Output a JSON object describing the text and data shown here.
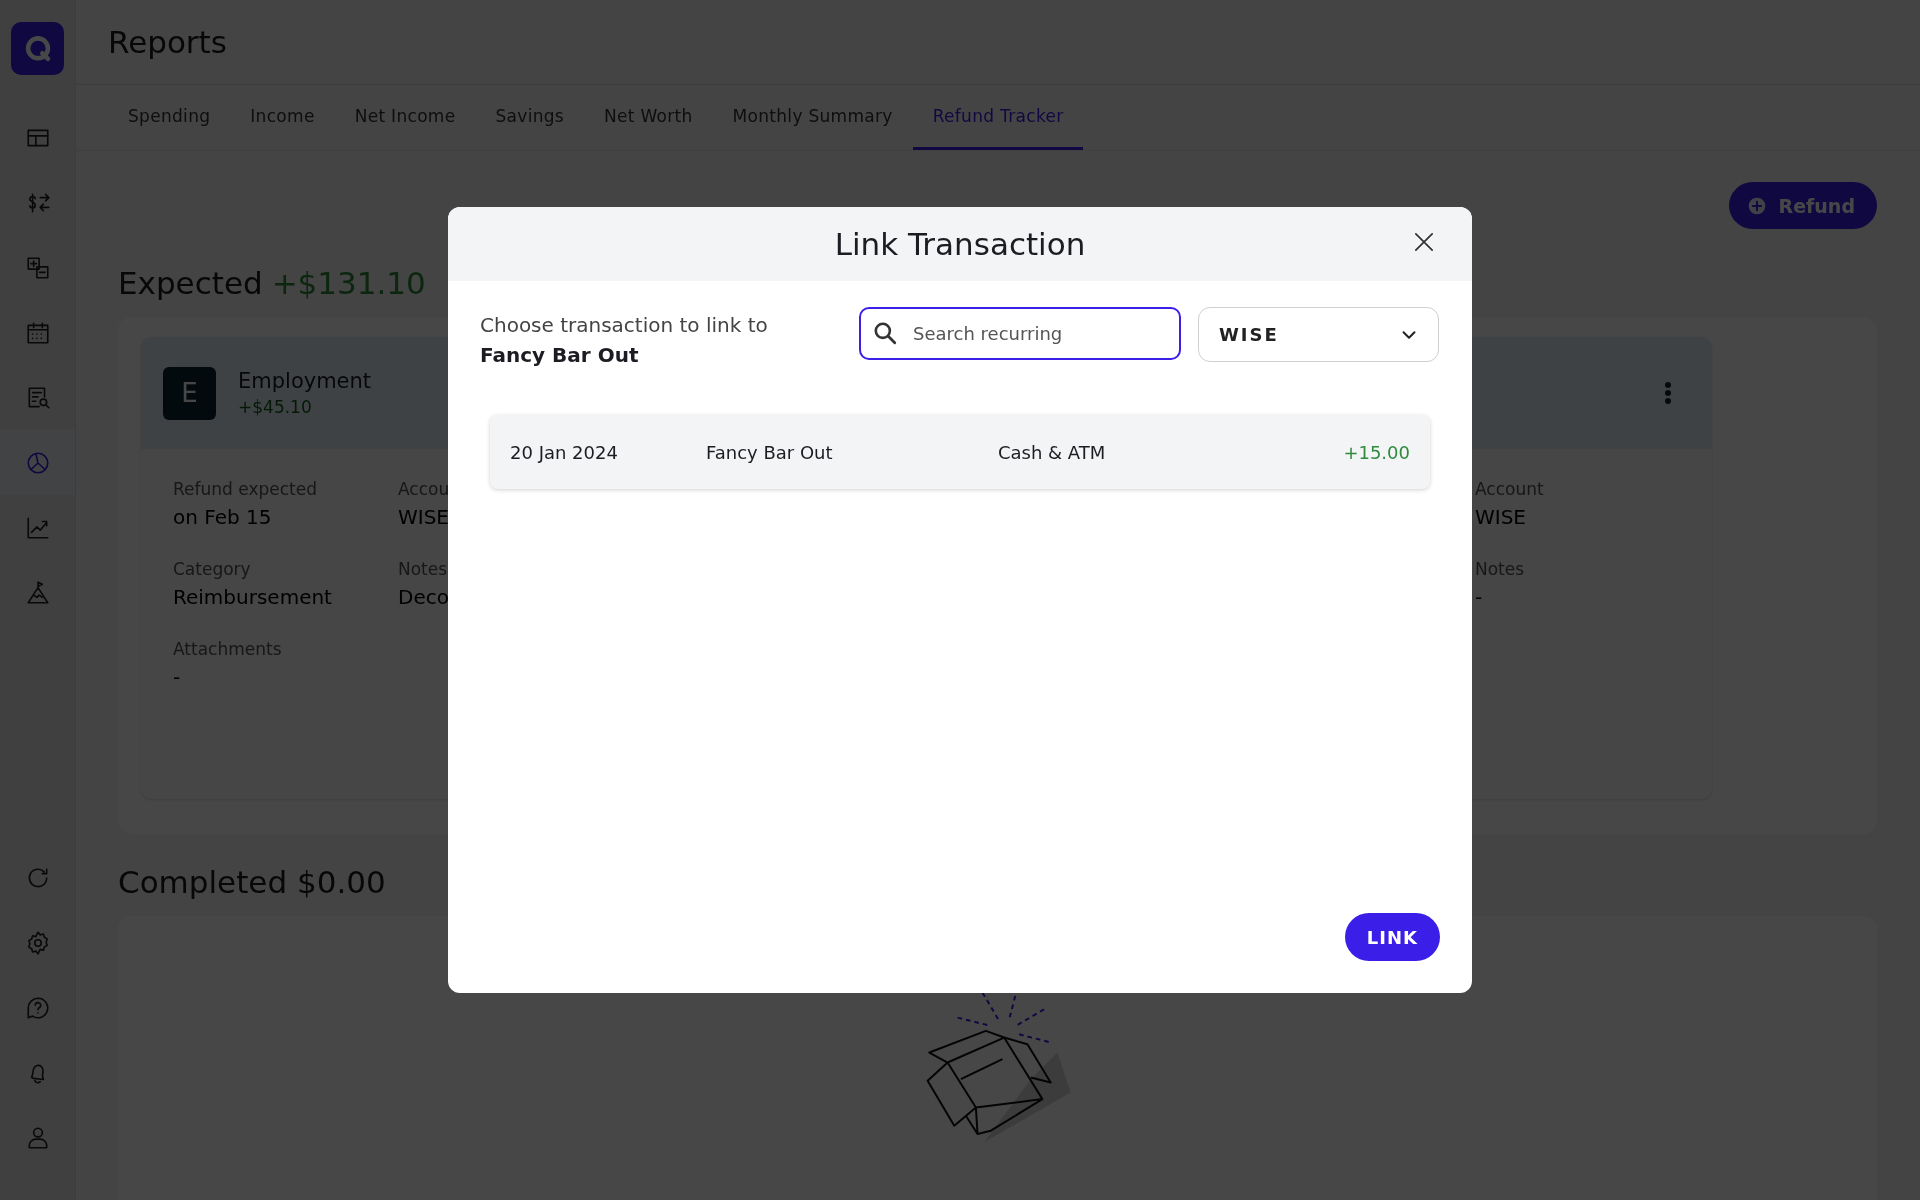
{
  "sidebar": {
    "top_items": [
      {
        "kind": "dashboard",
        "selected": false
      },
      {
        "kind": "transactions",
        "selected": false
      },
      {
        "kind": "budget",
        "selected": false
      },
      {
        "kind": "calendar",
        "selected": false
      },
      {
        "kind": "search-report",
        "selected": false
      },
      {
        "kind": "reports",
        "selected": true
      },
      {
        "kind": "investments",
        "selected": false
      },
      {
        "kind": "goals",
        "selected": false
      }
    ],
    "bottom_items": [
      {
        "kind": "refresh",
        "selected": false
      },
      {
        "kind": "settings",
        "selected": false
      },
      {
        "kind": "help",
        "selected": false
      },
      {
        "kind": "notifications",
        "selected": false
      },
      {
        "kind": "profile",
        "selected": false
      }
    ]
  },
  "header": {
    "title": "Reports"
  },
  "tabs": [
    {
      "label": "Spending",
      "selected": false
    },
    {
      "label": "Income",
      "selected": false
    },
    {
      "label": "Net Income",
      "selected": false
    },
    {
      "label": "Savings",
      "selected": false
    },
    {
      "label": "Net Worth",
      "selected": false
    },
    {
      "label": "Monthly Summary",
      "selected": false
    },
    {
      "label": "Refund Tracker",
      "selected": true
    }
  ],
  "refund_button": {
    "label": "Refund"
  },
  "expected": {
    "title": "Expected",
    "amount": "+$131.10",
    "card": {
      "avatar": "E",
      "name": "Employment",
      "amount": "+$45.10",
      "columns": [
        {
          "fields": [
            {
              "label": "Refund expected",
              "value": "on Feb 15"
            },
            {
              "label": "Category",
              "value": "Reimbursement"
            },
            {
              "label": "Attachments",
              "value": "-"
            }
          ]
        },
        {
          "fields": [
            {
              "label": "Accou",
              "value": "WISE"
            },
            {
              "label": "Notes",
              "value": "Deco"
            }
          ]
        },
        {
          "fields": [
            {
              "label": "Account",
              "value": "WISE"
            },
            {
              "label": "Notes",
              "value": "-"
            }
          ]
        }
      ]
    }
  },
  "completed": {
    "title": "Completed $0.00"
  },
  "modal": {
    "title": "Link Transaction",
    "prompt": "Choose transaction to link to",
    "target": "Fancy Bar Out",
    "search": {
      "placeholder": "Search recurring"
    },
    "account_select": {
      "value": "WISE"
    },
    "transactions": [
      {
        "date": "20 Jan 2024",
        "name": "Fancy Bar Out",
        "category": "Cash & ATM",
        "amount": "+15.00"
      }
    ],
    "link_button": {
      "label": "LINK"
    }
  }
}
